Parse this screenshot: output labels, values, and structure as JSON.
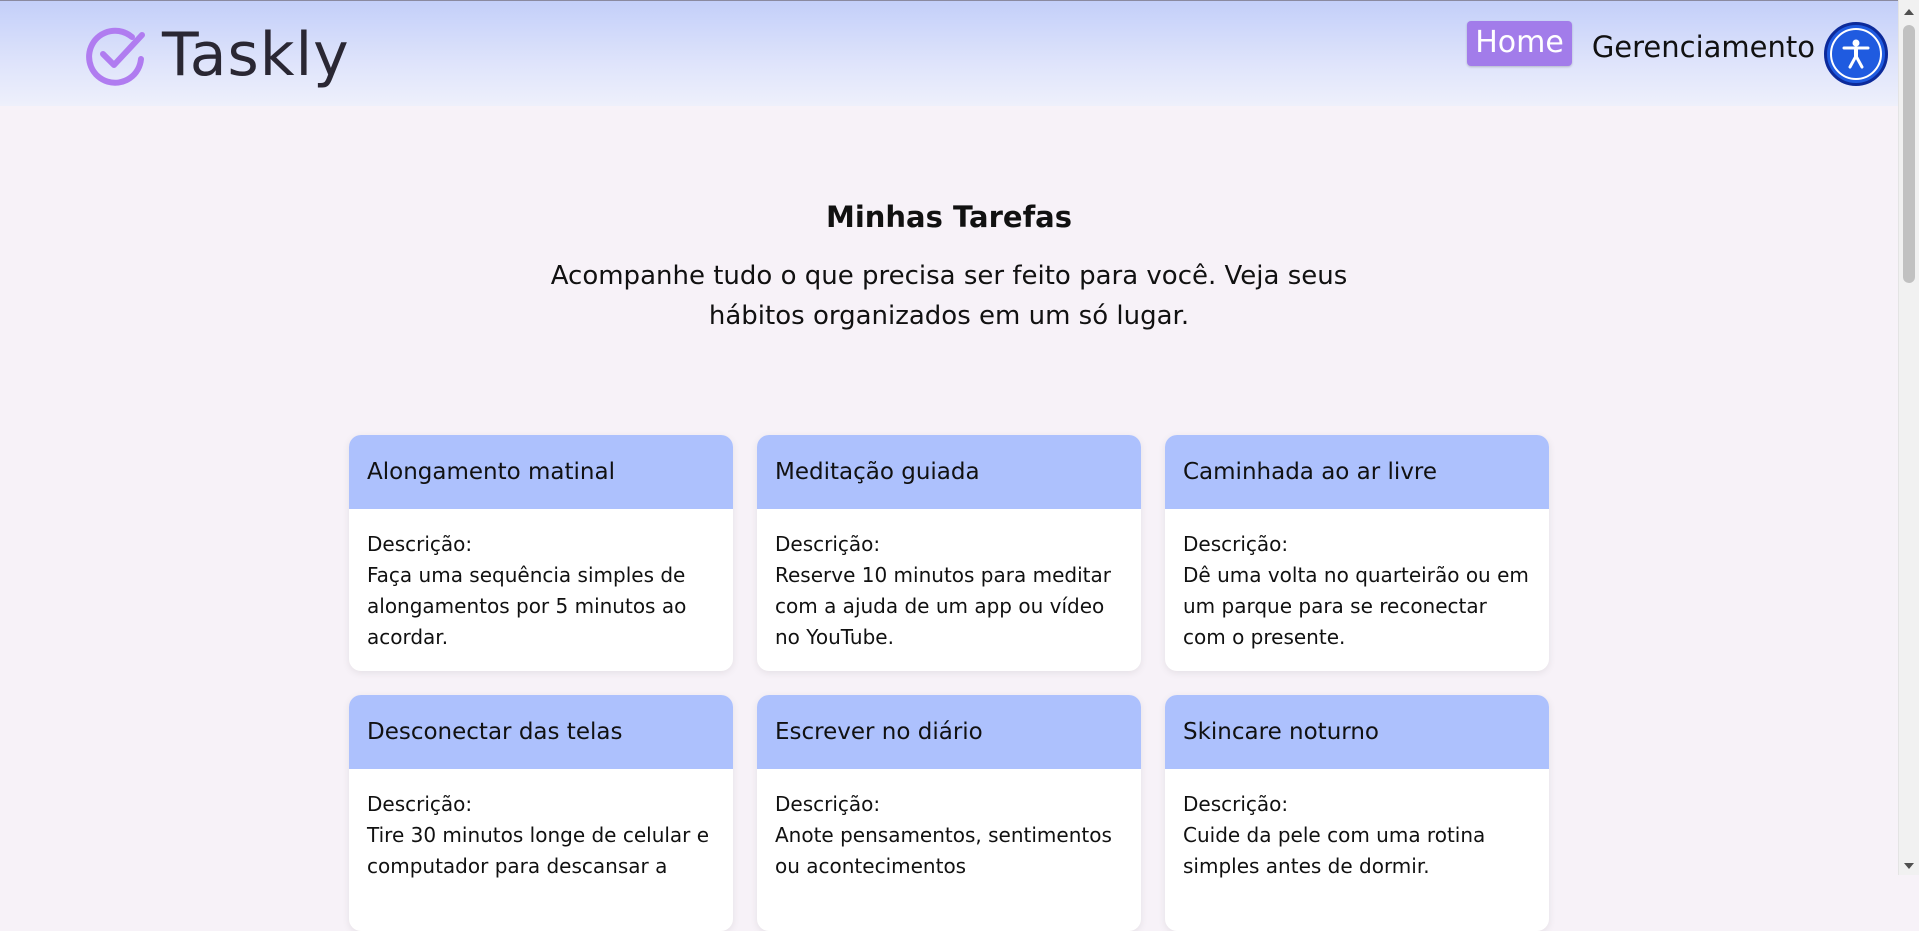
{
  "header": {
    "brand_name": "Taskly",
    "nav": {
      "home_label": "Home",
      "manage_label": "Gerenciamento"
    },
    "logo_icon": "check-circle-icon",
    "accessibility_icon": "accessibility-icon"
  },
  "main": {
    "title": "Minhas Tarefas",
    "subtitle": "Acompanhe tudo o que precisa ser feito para você. Veja seus hábitos organizados em um só lugar.",
    "description_label": "Descrição:",
    "tasks": [
      {
        "title": "Alongamento matinal",
        "description": "Faça uma sequência simples de alongamentos por 5 minutos ao acordar."
      },
      {
        "title": "Meditação guiada",
        "description": "Reserve 10 minutos para meditar com a ajuda de um app ou vídeo no YouTube."
      },
      {
        "title": "Caminhada ao ar livre",
        "description": "Dê uma volta no quarteirão ou em um parque para se reconectar com o presente."
      },
      {
        "title": "Desconectar das telas",
        "description": "Tire 30 minutos longe de celular e computador para descansar a"
      },
      {
        "title": "Escrever no diário",
        "description": "Anote pensamentos, sentimentos ou acontecimentos"
      },
      {
        "title": "Skincare noturno",
        "description": "Cuide da pele com uma rotina simples antes de dormir."
      }
    ]
  },
  "colors": {
    "accent": "#a27cea",
    "card_header": "#adc1fd",
    "accessibility": "#1f5be0"
  }
}
